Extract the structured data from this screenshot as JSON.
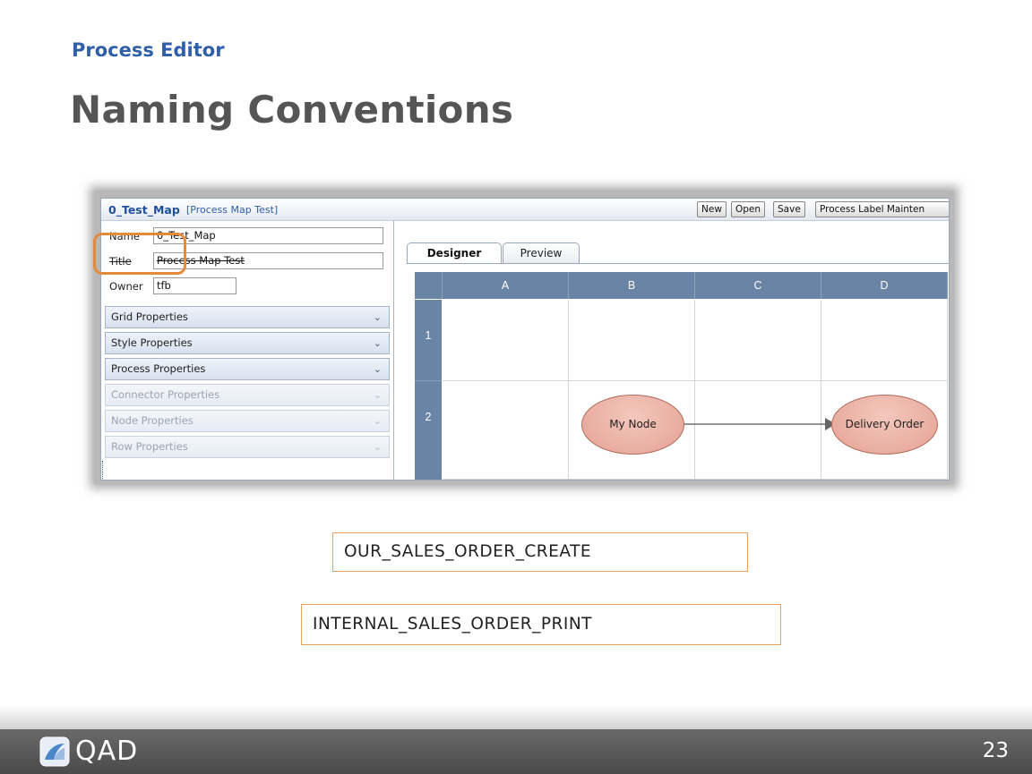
{
  "slide": {
    "eyebrow": "Process Editor",
    "title": "Naming Conventions",
    "page_number": "23",
    "logo_text": "QAD"
  },
  "app": {
    "title": "0_Test_Map",
    "subtitle": "[Process Map Test]",
    "toolbar": {
      "new_label": "New",
      "open_label": "Open",
      "save_label": "Save",
      "label_maint_label": "Process Label Mainten"
    },
    "form": {
      "name_label": "Name",
      "name_value": "0_Test_Map",
      "title_label": "Title",
      "title_value": "Process Map Test",
      "owner_label": "Owner",
      "owner_value": "tfb"
    },
    "properties": [
      {
        "label": "Grid Properties",
        "enabled": true
      },
      {
        "label": "Style Properties",
        "enabled": true
      },
      {
        "label": "Process Properties",
        "enabled": true
      },
      {
        "label": "Connector Properties",
        "enabled": false
      },
      {
        "label": "Node Properties",
        "enabled": false
      },
      {
        "label": "Row Properties",
        "enabled": false
      }
    ],
    "tabs": [
      {
        "label": "Designer",
        "active": true
      },
      {
        "label": "Preview",
        "active": false
      }
    ],
    "grid": {
      "columns": [
        "A",
        "B",
        "C",
        "D"
      ],
      "rows": [
        "1",
        "2"
      ],
      "nodes": [
        {
          "label": "My Node",
          "row": "2",
          "col": "B"
        },
        {
          "label": "Delivery Order",
          "row": "2",
          "col": "D"
        }
      ]
    }
  },
  "examples": [
    "OUR_SALES_ORDER_CREATE",
    "INTERNAL_SALES_ORDER_PRINT"
  ],
  "colors": {
    "accent_blue": "#2f5fa8",
    "highlight_orange": "#e38b3a",
    "grid_header": "#6a84a5",
    "node_fill": "#e9ada0",
    "footer": "#555555"
  }
}
